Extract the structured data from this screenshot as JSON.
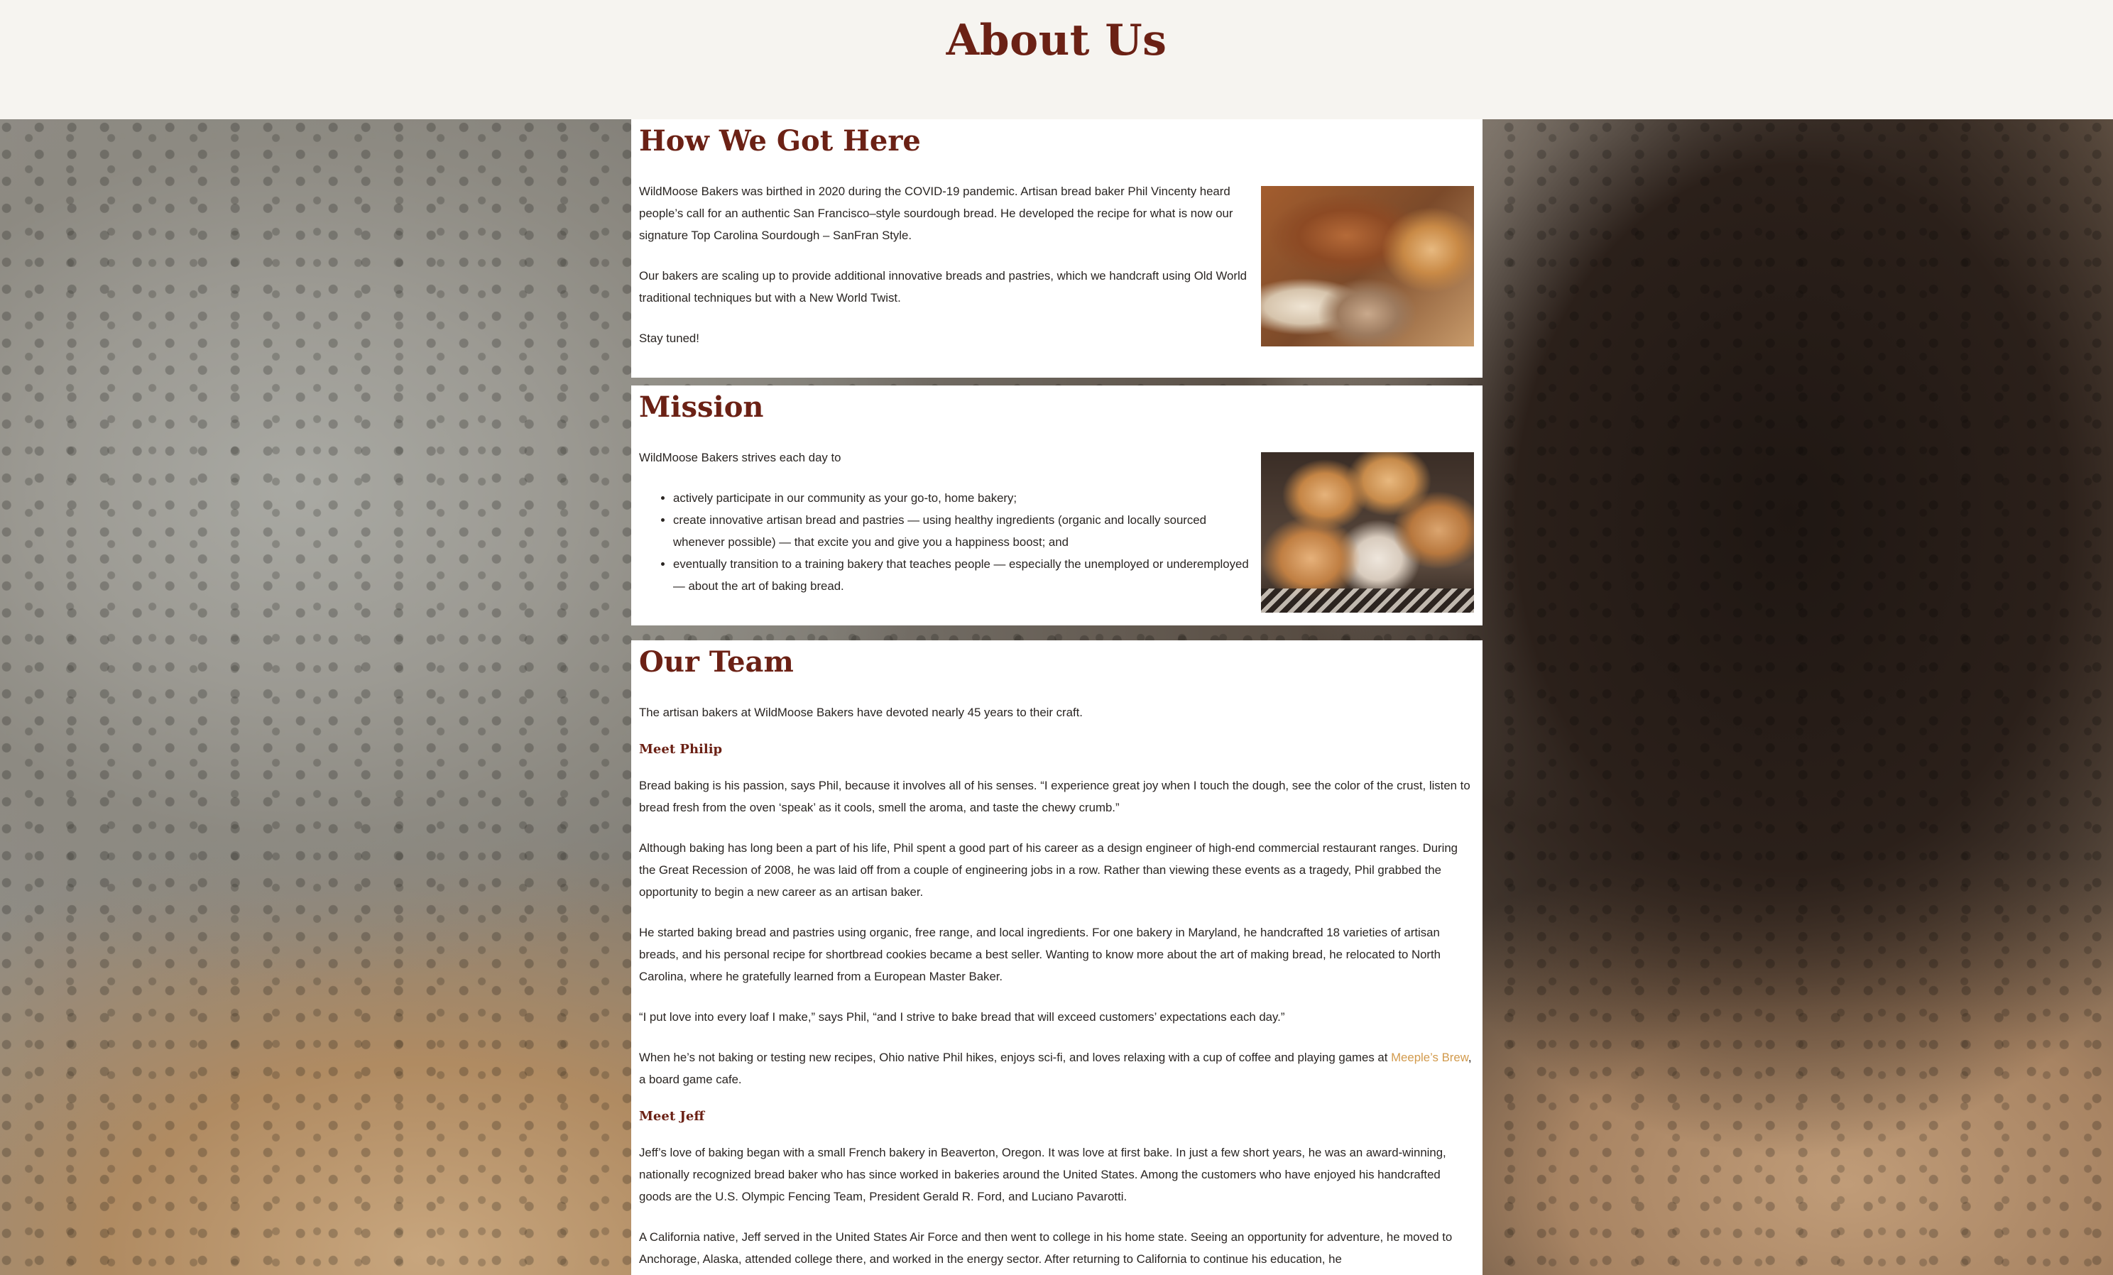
{
  "header": {
    "title": "About Us"
  },
  "sections": {
    "history": {
      "title": "How We Got Here",
      "paragraphs": [
        "WildMoose Bakers was birthed in 2020 during the COVID-19 pandemic. Artisan bread baker Phil Vincenty heard people’s call for an authentic San Francisco–style sourdough bread. He developed the recipe for what is now our signature Top Carolina Sourdough – SanFran Style.",
        "Our bakers are scaling up to provide additional innovative breads and pastries, which we handcraft using Old World traditional techniques but with a New World Twist.",
        "Stay tuned!"
      ],
      "image_alt": "Assorted artisan breads"
    },
    "mission": {
      "title": "Mission",
      "intro": "WildMoose Bakers strives each day to",
      "items": [
        "actively participate in our community as your go-to, home bakery;",
        "create innovative artisan bread and pastries — using healthy ingredients (organic and locally sourced whenever possible) — that excite you and give you a happiness boost; and",
        "eventually transition to a training bakery that teaches people — especially the unemployed or underemployed — about the art of baking bread."
      ],
      "image_alt": "Basket of bread rolls"
    },
    "team": {
      "title": "Our Team",
      "intro": "The artisan bakers at WildMoose Bakers have devoted nearly 45 years to their craft.",
      "philip": {
        "heading": "Meet Philip",
        "paragraphs": [
          "Bread baking is his passion, says Phil, because it involves all of his senses. “I experience great joy when I touch the dough, see the color of the crust, listen to bread fresh from the oven ‘speak’ as it cools, smell the aroma, and taste the chewy crumb.”",
          "Although baking has long been a part of his life, Phil spent a good part of his career as a design engineer of high-end commercial restaurant ranges. During the Great Recession of 2008, he was laid off from a couple of engineering jobs in a row. Rather than viewing these events as a tragedy, Phil grabbed the opportunity to begin a new career as an artisan baker.",
          "He started baking bread and pastries using organic, free range, and local ingredients. For one bakery in Maryland, he handcrafted 18 varieties of artisan breads, and his personal recipe for shortbread cookies became a best seller. Wanting to know more about the art of making bread, he relocated to North Carolina, where he gratefully learned from a European Master Baker.",
          "“I put love into every loaf I make,” says Phil, “and I strive to bake bread that will exceed customers’ expectations each day.”"
        ],
        "hobbies_before": "When he’s not baking or testing new recipes, Ohio native Phil hikes, enjoys sci-fi, and loves relaxing with a cup of coffee and playing games at ",
        "hobbies_link": "Meeple’s Brew",
        "hobbies_after": ", a board game cafe."
      },
      "jeff": {
        "heading": "Meet Jeff",
        "paragraphs": [
          "Jeff’s love of baking began with a small French bakery in Beaverton, Oregon. It was love at first bake. In just a few short years, he was an award-winning, nationally recognized bread baker who has since worked in bakeries around the United States. Among the customers who have enjoyed his handcrafted goods are the U.S. Olympic Fencing Team, President Gerald R. Ford, and Luciano Pavarotti.",
          "A California native, Jeff served in the United States Air Force and then went to college in his home state. Seeing an opportunity for adventure, he moved to Anchorage, Alaska, attended college there, and worked in the energy sector. After returning to California to continue his education, he"
        ]
      }
    }
  },
  "colors": {
    "heading": "#6b2115",
    "link": "#d29a4c",
    "header_bg": "#f6f4f0",
    "card_bg": "#ffffff"
  }
}
